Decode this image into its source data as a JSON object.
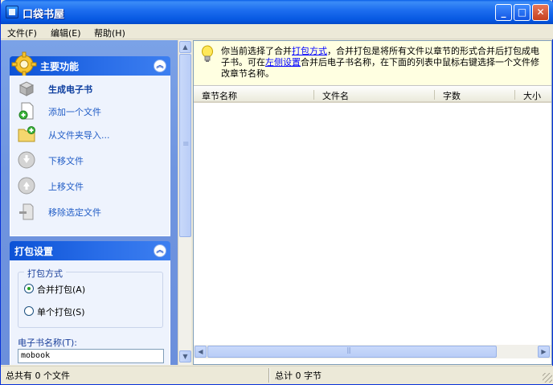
{
  "window": {
    "title": "口袋书屋"
  },
  "menu": [
    {
      "label": "文件(F)"
    },
    {
      "label": "编辑(E)"
    },
    {
      "label": "帮助(H)"
    }
  ],
  "left": {
    "main_group": {
      "title": "主要功能",
      "items": [
        {
          "label": "生成电子书",
          "icon": "box-icon"
        },
        {
          "label": "添加一个文件",
          "icon": "add-file-icon"
        },
        {
          "label": "从文件夹导入...",
          "icon": "folder-add-icon"
        },
        {
          "label": "下移文件",
          "icon": "arrow-down-icon"
        },
        {
          "label": "上移文件",
          "icon": "arrow-up-icon"
        },
        {
          "label": "移除选定文件",
          "icon": "remove-file-icon"
        }
      ]
    },
    "pack_group": {
      "title": "打包设置",
      "fieldset_label": "打包方式",
      "options": [
        {
          "label": "合并打包(A)",
          "checked": true
        },
        {
          "label": "单个打包(S)",
          "checked": false
        }
      ],
      "name_label": "电子书名称(T):",
      "name_value": "mobook"
    }
  },
  "info": {
    "p1": "你当前选择了合并",
    "link1": "打包方式",
    "p2": "，合并打包是将所有文件以章节的形式合并后打包成电子书。可在",
    "link2": "左侧设置",
    "p3": "合并后电子书名称，在下面的列表中鼠标右键选择一个文件修改章节名称。"
  },
  "columns": [
    "章节名称",
    "文件名",
    "字数",
    "大小"
  ],
  "status": {
    "left": "总共有 0 个文件",
    "right": "总计 0 字节"
  },
  "colors": {
    "title_bar": "#0a5fe8",
    "task_link": "#215dc6",
    "panel_bg": "#7ba2e7"
  }
}
